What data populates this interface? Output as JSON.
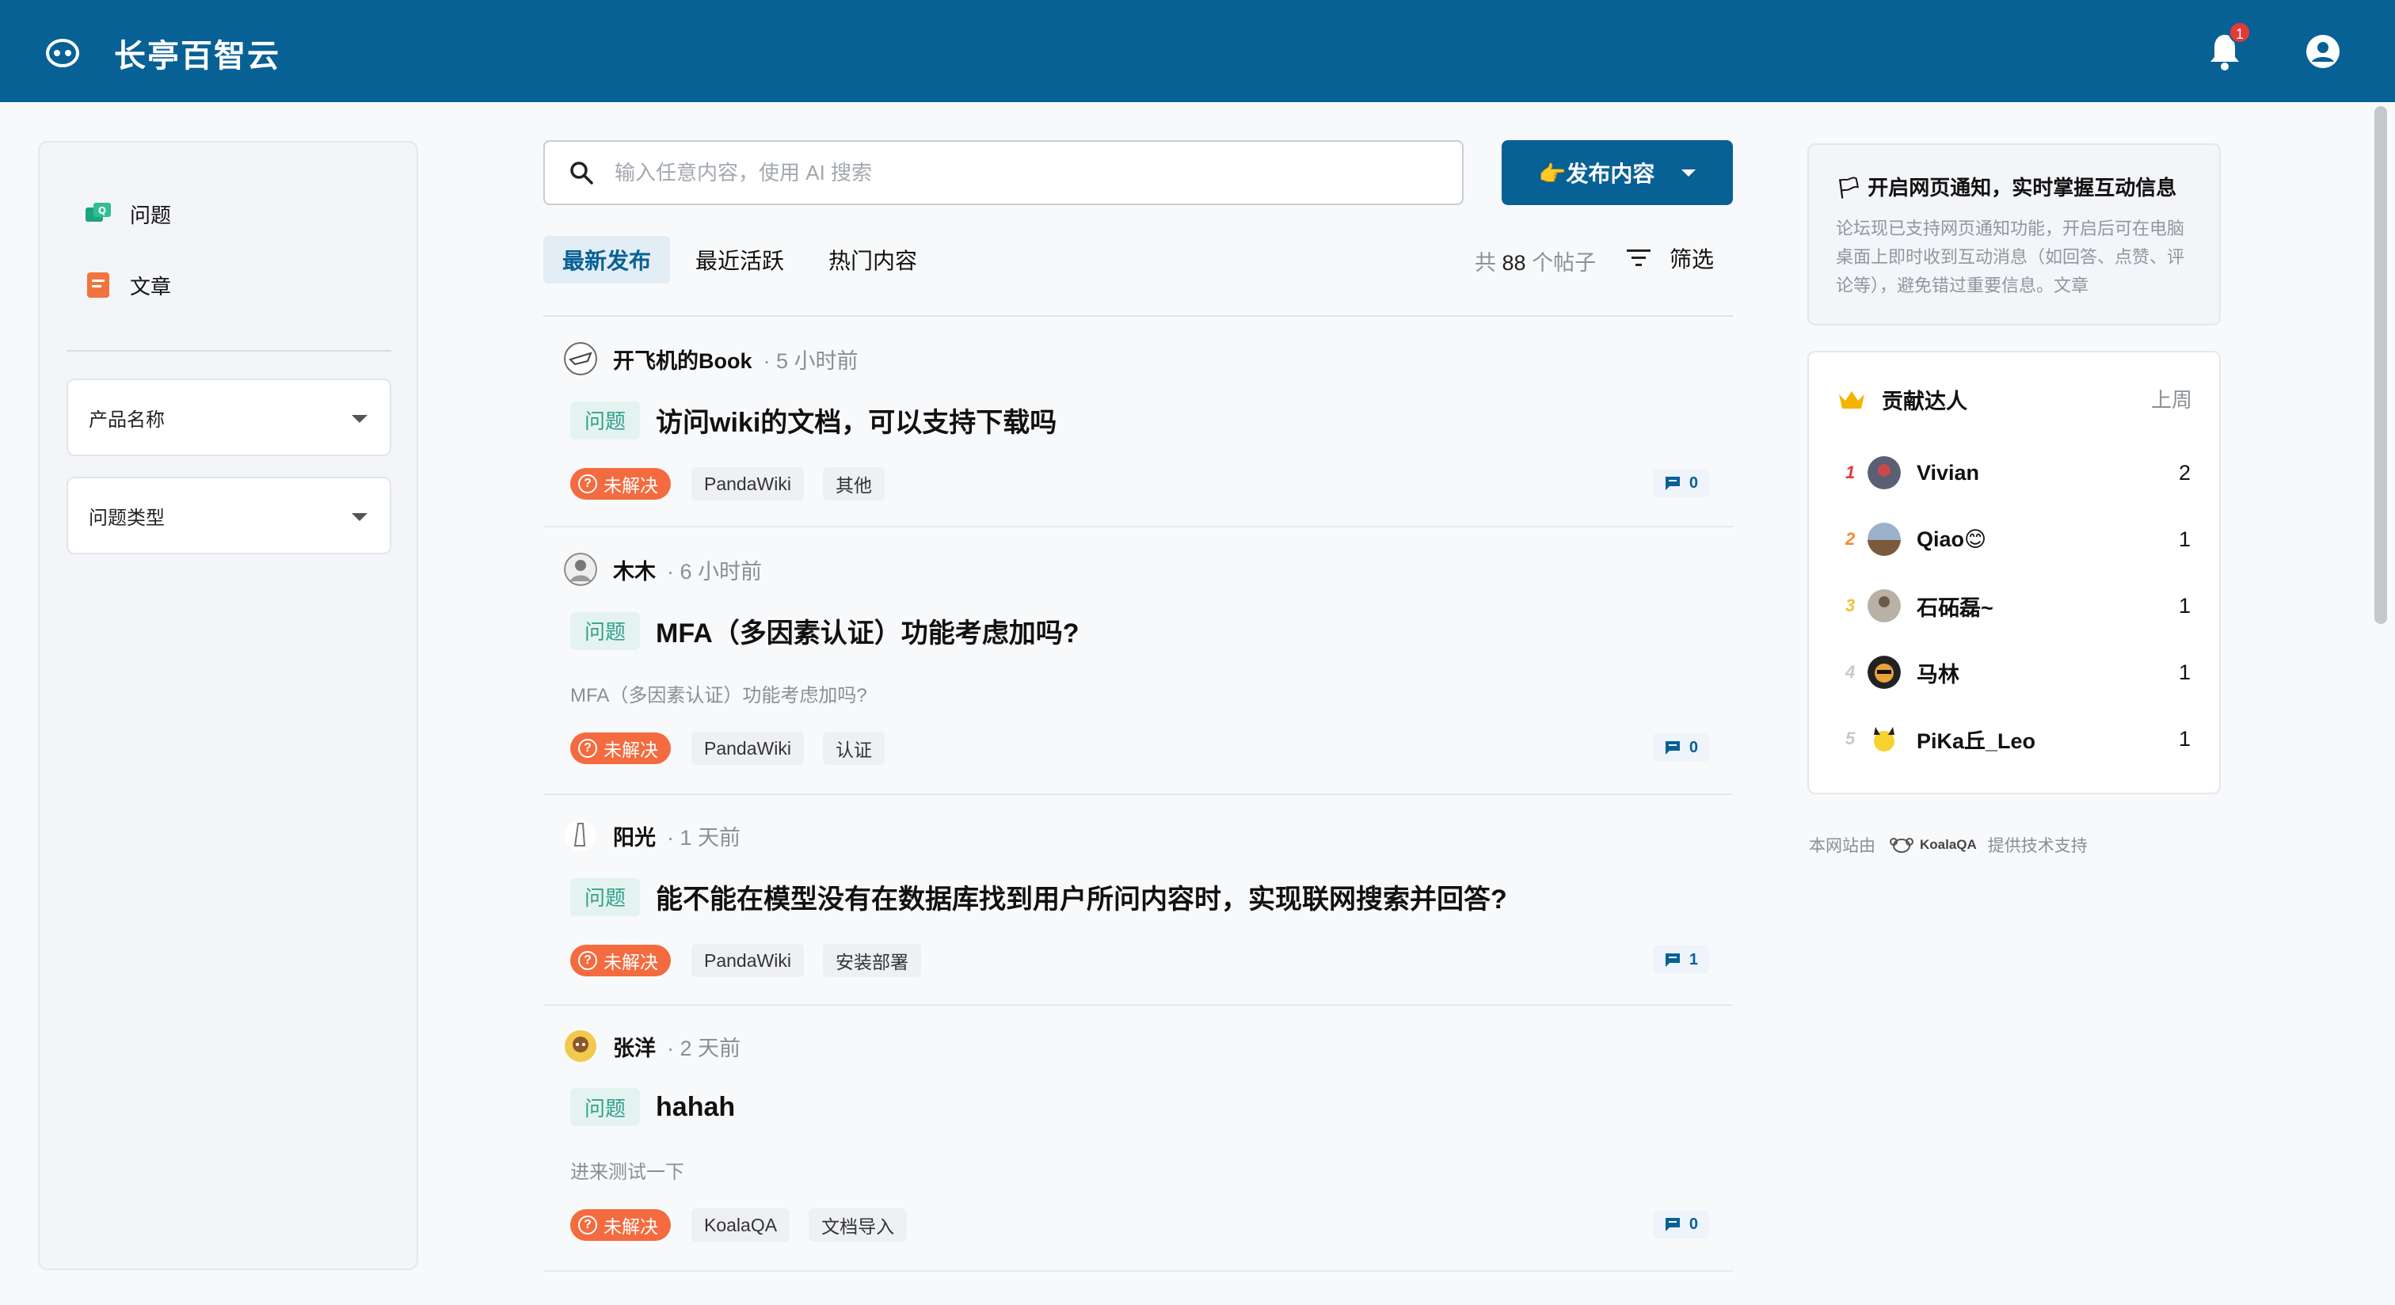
{
  "app": {
    "brand": "长亭百智云",
    "notification_count": "1"
  },
  "sidebar": {
    "nav": [
      {
        "label": "问题",
        "icon": "question-chat-icon"
      },
      {
        "label": "文章",
        "icon": "article-icon"
      }
    ],
    "filters": [
      {
        "label": "产品名称"
      },
      {
        "label": "问题类型"
      }
    ]
  },
  "search": {
    "placeholder": "输入任意内容，使用 AI 搜索"
  },
  "publish": {
    "label": "👉发布内容"
  },
  "tabs": [
    {
      "label": "最新发布",
      "active": true
    },
    {
      "label": "最近活跃",
      "active": false
    },
    {
      "label": "热门内容",
      "active": false
    }
  ],
  "feed": {
    "count_prefix": "共",
    "count_value": "88",
    "count_suffix": "个帖子",
    "filter_label": "筛选",
    "posts": [
      {
        "author": "开飞机的Book",
        "time": "· 5 小时前",
        "type": "问题",
        "title": "访问wiki的文档，可以支持下载吗",
        "excerpt": "",
        "status": "未解决",
        "tags": [
          "PandaWiki",
          "其他"
        ],
        "comments": "0"
      },
      {
        "author": "木木",
        "time": "· 6 小时前",
        "type": "问题",
        "title": "MFA（多因素认证）功能考虑加吗?",
        "excerpt": "MFA（多因素认证）功能考虑加吗?",
        "status": "未解决",
        "tags": [
          "PandaWiki",
          "认证"
        ],
        "comments": "0"
      },
      {
        "author": "阳光",
        "time": "· 1 天前",
        "type": "问题",
        "title": "能不能在模型没有在数据库找到用户所问内容时，实现联网搜索并回答?",
        "excerpt": "",
        "status": "未解决",
        "tags": [
          "PandaWiki",
          "安装部署"
        ],
        "comments": "1"
      },
      {
        "author": "张洋",
        "time": "· 2 天前",
        "type": "问题",
        "title": "hahah",
        "excerpt": "进来测试一下",
        "status": "未解决",
        "tags": [
          "KoalaQA",
          "文档导入"
        ],
        "comments": "0"
      }
    ]
  },
  "notice": {
    "title": "🏳 开启网页通知，实时掌握互动信息",
    "body": "论坛现已支持网页通知功能，开启后可在电脑桌面上即时收到互动消息（如回答、点赞、评论等），避免错过重要信息。文章"
  },
  "contributors": {
    "title": "贡献达人",
    "period": "上周",
    "list": [
      {
        "rank": "1",
        "name": "Vivian",
        "score": "2",
        "color": "#e53935"
      },
      {
        "rank": "2",
        "name": "Qiao😊",
        "score": "1",
        "color": "#f38b2a"
      },
      {
        "rank": "3",
        "name": "石砳磊~",
        "score": "1",
        "color": "#f1c232"
      },
      {
        "rank": "4",
        "name": "马林",
        "score": "1",
        "color": "#c5c9cf"
      },
      {
        "rank": "5",
        "name": "PiKa丘_Leo",
        "score": "1",
        "color": "#c5c9cf"
      }
    ]
  },
  "footer": {
    "prefix": "本网站由",
    "brand": "KoalaQA",
    "suffix": "提供技术支持"
  },
  "colors": {
    "header": "#086195",
    "accent": "#086195",
    "status": "#f36b3f"
  }
}
